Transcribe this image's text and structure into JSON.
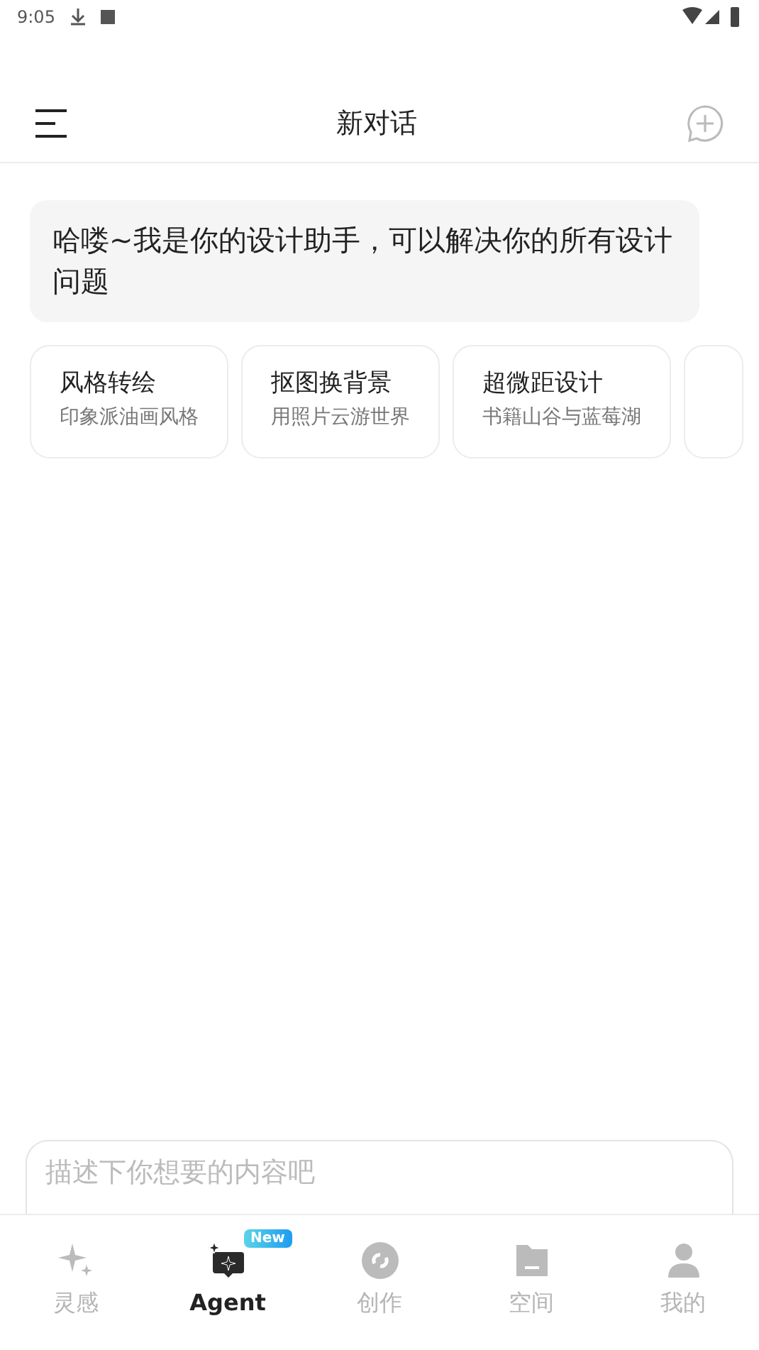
{
  "status_bar": {
    "time": "9:05"
  },
  "header": {
    "title": "新对话"
  },
  "message": "哈喽~我是你的设计助手，可以解决你的所有设计问题",
  "suggestions": [
    {
      "title": "风格转绘",
      "subtitle": "印象派油画风格"
    },
    {
      "title": "抠图换背景",
      "subtitle": "用照片云游世界"
    },
    {
      "title": "超微距设计",
      "subtitle": "书籍山谷与蓝莓湖"
    }
  ],
  "input": {
    "placeholder": "描述下你想要的内容吧"
  },
  "tabs": [
    {
      "label": "灵感",
      "kind": "sparkle",
      "selected": false
    },
    {
      "label": "Agent",
      "kind": "agent",
      "selected": true,
      "badge": "New"
    },
    {
      "label": "创作",
      "kind": "create",
      "selected": false
    },
    {
      "label": "空间",
      "kind": "folder",
      "selected": false
    },
    {
      "label": "我的",
      "kind": "person",
      "selected": false
    }
  ]
}
